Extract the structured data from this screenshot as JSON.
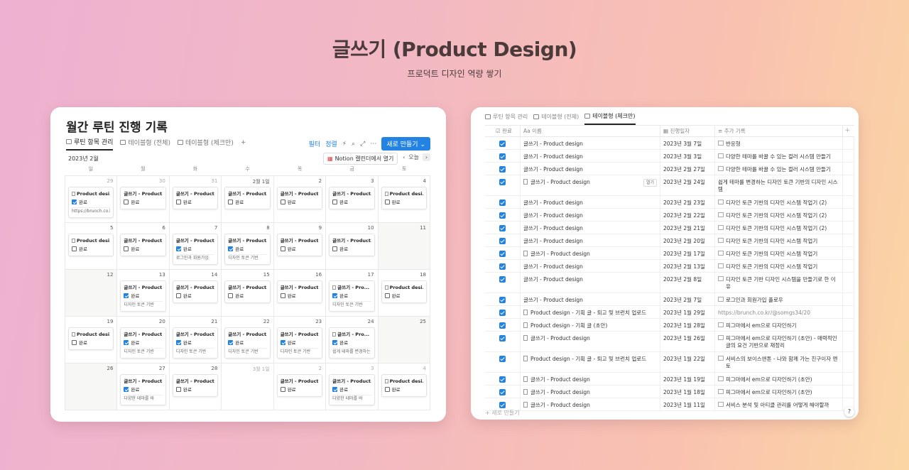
{
  "hero": {
    "title": "글쓰기 (Product Design)",
    "subtitle": "프로덕트 디자인 역량 쌓기"
  },
  "calendar": {
    "title": "월간 루틴 진행 기록",
    "views": [
      "루틴 항목 관리",
      "테이블형 (전체)",
      "테이블형 (체크만)"
    ],
    "toolbar": {
      "filter": "필터",
      "sort": "정렬",
      "new": "새로 만들기"
    },
    "month": "2023년 2월",
    "open_in": "Notion 캘린더에서 열기",
    "today": "오늘",
    "weekdays": [
      "일",
      "월",
      "화",
      "수",
      "목",
      "금",
      "토"
    ],
    "done_label": "완료",
    "days": [
      {
        "n": "29",
        "dim": true,
        "ev": {
          "t": "Product desi...",
          "c": true,
          "x": "https://brunch.co.kr/@",
          "pg": true
        }
      },
      {
        "n": "30",
        "dim": true,
        "ev": {
          "t": "글쓰기 - Product...",
          "c": false
        }
      },
      {
        "n": "31",
        "dim": true,
        "ev": {
          "t": "글쓰기 - Product...",
          "c": false
        }
      },
      {
        "n": "2월 1일",
        "ev": {
          "t": "글쓰기 - Product...",
          "c": false
        }
      },
      {
        "n": "2",
        "ev": {
          "t": "글쓰기 - Product...",
          "c": false
        }
      },
      {
        "n": "3",
        "ev": {
          "t": "글쓰기 - Product...",
          "c": false
        }
      },
      {
        "n": "4",
        "ev": {
          "t": "Product desi...",
          "c": false,
          "pg": true
        }
      },
      {
        "n": "5",
        "ev": {
          "t": "Product desi...",
          "c": false,
          "pg": true
        }
      },
      {
        "n": "6",
        "ev": {
          "t": "글쓰기 - Product...",
          "c": false
        }
      },
      {
        "n": "7",
        "ev": {
          "t": "글쓰기 - Product...",
          "c": true,
          "x": "로그인과 회원가입"
        }
      },
      {
        "n": "8",
        "ev": {
          "t": "글쓰기 - Product...",
          "c": true,
          "x": "디자인 토큰 기반"
        }
      },
      {
        "n": "9",
        "ev": {
          "t": "글쓰기 - Product...",
          "c": false
        }
      },
      {
        "n": "10",
        "ev": {
          "t": "글쓰기 - Product...",
          "c": false
        }
      },
      {
        "n": "11"
      },
      {
        "n": "12"
      },
      {
        "n": "13",
        "ev": {
          "t": "글쓰기 - Product...",
          "c": true,
          "x": "디자인 토큰 기반"
        }
      },
      {
        "n": "14",
        "ev": {
          "t": "글쓰기 - Product...",
          "c": false
        }
      },
      {
        "n": "15",
        "ev": {
          "t": "글쓰기 - Product...",
          "c": false
        }
      },
      {
        "n": "16",
        "ev": {
          "t": "글쓰기 - Product...",
          "c": false
        }
      },
      {
        "n": "17",
        "ev": {
          "t": "글쓰기 - Pro...",
          "c": true,
          "x": "디자인 토큰 기반",
          "pg": true
        }
      },
      {
        "n": "18",
        "ev": {
          "t": "Product desi...",
          "c": false,
          "pg": true
        }
      },
      {
        "n": "19",
        "ev": {
          "t": "Product desi...",
          "c": false,
          "pg": true
        }
      },
      {
        "n": "20",
        "ev": {
          "t": "글쓰기 - Product...",
          "c": true,
          "x": "디자인 토큰 기반"
        }
      },
      {
        "n": "21",
        "ev": {
          "t": "글쓰기 - Product...",
          "c": true,
          "x": "디자인 토큰 기반"
        }
      },
      {
        "n": "22",
        "ev": {
          "t": "글쓰기 - Product...",
          "c": true,
          "x": "디자인 토큰 기반"
        }
      },
      {
        "n": "23",
        "ev": {
          "t": "글쓰기 - Product...",
          "c": true,
          "x": "디자인 토큰 기반"
        }
      },
      {
        "n": "24",
        "ev": {
          "t": "글쓰기 - Pro...",
          "c": true,
          "x": "쉽게 테마를 변경하는",
          "pg": true
        }
      },
      {
        "n": "25"
      },
      {
        "n": "26"
      },
      {
        "n": "27",
        "ev": {
          "t": "글쓰기 - Product...",
          "c": true,
          "x": "다양한 테마를 바"
        }
      },
      {
        "n": "28",
        "ev": {
          "t": "글쓰기 - Product...",
          "c": false
        }
      },
      {
        "n": "3월 1일",
        "dim": true
      },
      {
        "n": "2",
        "dim": true,
        "ev": {
          "t": "글쓰기 - Product...",
          "c": false
        }
      },
      {
        "n": "3",
        "dim": true,
        "ev": {
          "t": "글쓰기 - Product...",
          "c": true,
          "x": "다양한 테마를 바"
        }
      },
      {
        "n": "4",
        "dim": true,
        "ev": {
          "t": "Product desi...",
          "c": false,
          "pg": true
        }
      }
    ]
  },
  "table": {
    "tabs": [
      "루틴 항목 관리",
      "테이블형 (전체)",
      "테이블형 (체크만)"
    ],
    "columns": [
      "완료",
      "Aa 이름",
      "진행일자",
      "추가 기록"
    ],
    "open_label": "열기",
    "add_new": "새로 만들기",
    "help": "?",
    "rows": [
      {
        "name": "글쓰기 - Product design",
        "date": "2023년 3월 7일",
        "note": "반응형",
        "pg": false,
        "ni": true
      },
      {
        "name": "글쓰기 - Product design",
        "date": "2023년 3월 3일",
        "note": "다양한 테마를 바꿀 수 있는 컬러 시스템 만들기",
        "pg": false,
        "ni": true
      },
      {
        "name": "글쓰기 - Product design",
        "date": "2023년 2월 27일",
        "note": "다양한 테마를 바꿀 수 있는 컬러 시스템 만들기",
        "pg": false,
        "ni": true
      },
      {
        "name": "글쓰기 - Product design",
        "date": "2023년 2월 24일",
        "note": "쉽게 테마를 변경하는 디자인 토큰 기반의 디자인 시스템",
        "pg": true,
        "ni": false,
        "tall": true,
        "open": true
      },
      {
        "name": "글쓰기 - Product design",
        "date": "2023년 2월 23일",
        "note": "디자인 토큰 기반의 디자인 시스템 작업기 (2)",
        "pg": false,
        "ni": true
      },
      {
        "name": "글쓰기 - Product design",
        "date": "2023년 2월 22일",
        "note": "디자인 토큰 기반의 디자인 시스템 작업기 (2)",
        "pg": false,
        "ni": true
      },
      {
        "name": "글쓰기 - Product design",
        "date": "2023년 2월 21일",
        "note": "디자인 토큰 기반의 디자인 시스템 작업기 (2)",
        "pg": false,
        "ni": true
      },
      {
        "name": "글쓰기 - Product design",
        "date": "2023년 2월 20일",
        "note": "디자인 토큰 기반의 디자인 시스템 작업기",
        "pg": false,
        "ni": true
      },
      {
        "name": "글쓰기 - Product design",
        "date": "2023년 2월 17일",
        "note": "디자인 토큰 기반의 디자인 시스템 작업기",
        "pg": true,
        "ni": true
      },
      {
        "name": "글쓰기 - Product design",
        "date": "2023년 2월 13일",
        "note": "디자인 토큰 기반의 디자인 시스템 작업기",
        "pg": false,
        "ni": true
      },
      {
        "name": "글쓰기 - Product design",
        "date": "2023년 2월 8일",
        "note": "디자인 토큰 기반 디자인 시스템을 만들기로 한 이유",
        "pg": false,
        "ni": true,
        "tall": true
      },
      {
        "name": "글쓰기 - Product design",
        "date": "2023년 2월 7일",
        "note": "로그인과 회원가입 플로우",
        "pg": false,
        "ni": true
      },
      {
        "name": "Product design - 기획 글 - 퇴고 및 브런치 업로드",
        "date": "2023년 1월 29일",
        "note": "https://brunch.co.kr/@somgs34/20",
        "pg": true,
        "ni": false,
        "url": true
      },
      {
        "name": "Product design - 기획 글 (초안)",
        "date": "2023년 1월 28일",
        "note": "피그마에서 em으로 디자인하기",
        "pg": true,
        "ni": true
      },
      {
        "name": "글쓰기 - Product design",
        "date": "2023년 1월 26일",
        "note": "피그마에서 em으로 디자인하기 (초안) - 매력적인 글의 요건 기반으로 재정리",
        "pg": true,
        "ni": true,
        "tall": true
      },
      {
        "name": "Product design - 기획 글 - 퇴고 및 브런치 업로드",
        "date": "2023년 1월 22일",
        "note": "서비스의 보이스앤톤 - 나와 함께 가는 친구이자 멘토",
        "pg": true,
        "ni": true,
        "tall": true
      },
      {
        "name": "글쓰기 - Product design",
        "date": "2023년 1월 19일",
        "note": "피그마에서 em으로 디자인하기 (초안)",
        "pg": true,
        "ni": true
      },
      {
        "name": "글쓰기 - Product design",
        "date": "2023년 1월 18일",
        "note": "피그마에서 em으로 디자인하기 (초안)",
        "pg": true,
        "ni": true
      },
      {
        "name": "글쓰기 - Product design",
        "date": "2023년 1월 11일",
        "note": "서비스 분석 및 아티클 관리를 어떻게 해야할까",
        "pg": true,
        "ni": true
      }
    ]
  }
}
